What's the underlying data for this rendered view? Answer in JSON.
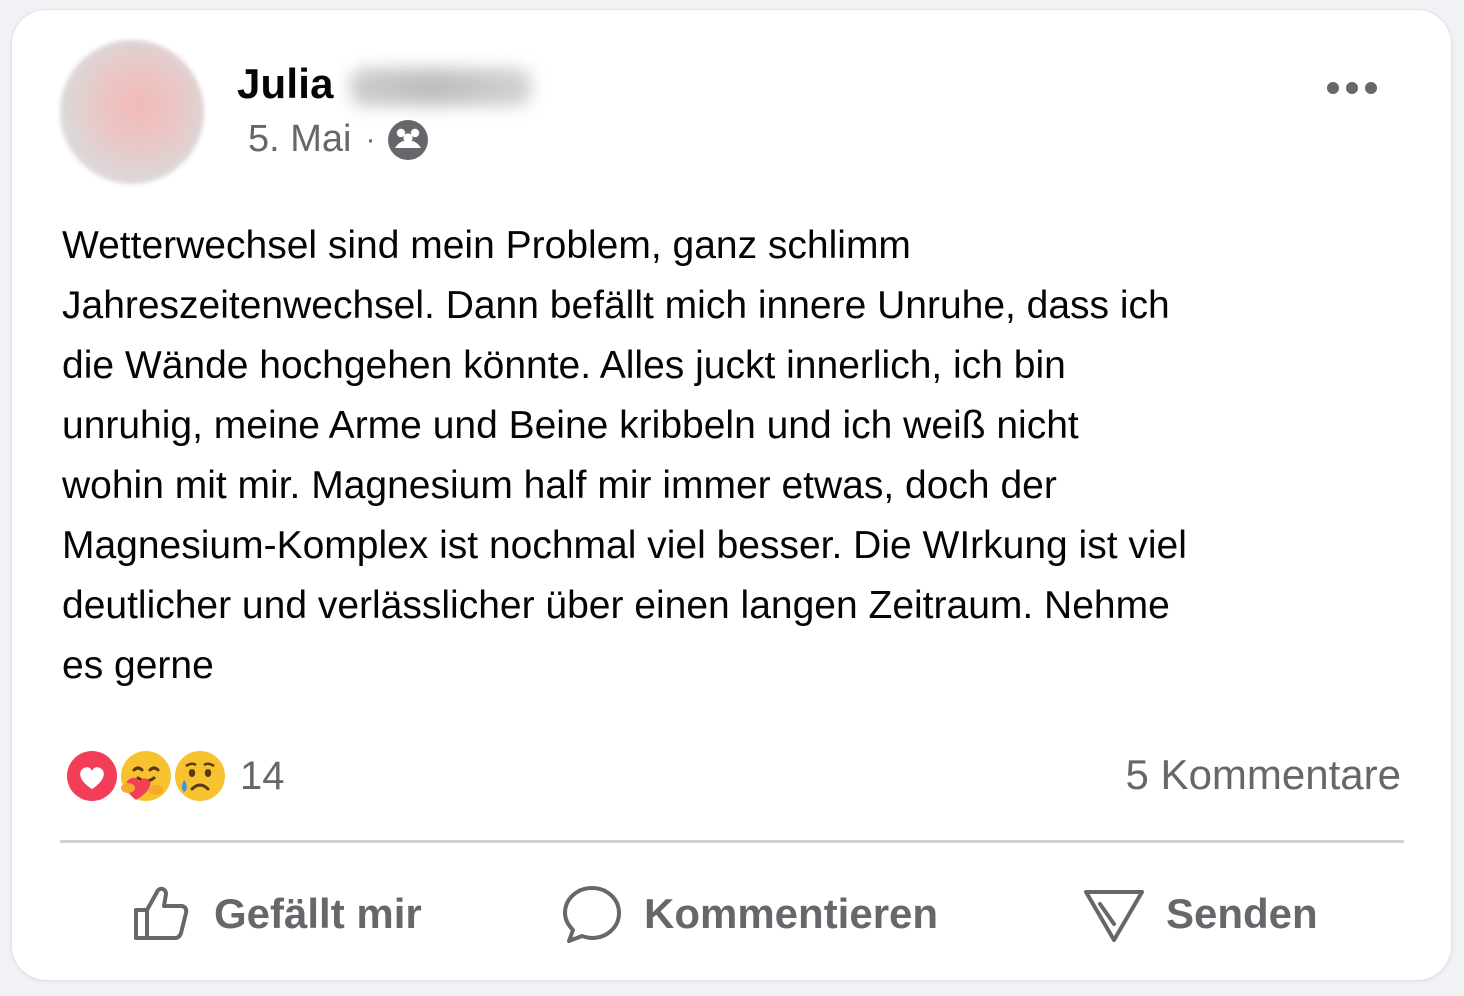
{
  "post": {
    "author_first_name": "Julia",
    "date": "5. Mai",
    "separator": "·",
    "audience_icon": "group-icon",
    "more_icon": "more-options-icon",
    "text": "Wetterwechsel sind mein Problem, ganz schlimm\nJahreszeitenwechsel. Dann befällt mich innere Unruhe, dass ich\ndie Wände hochgehen könnte. Alles juckt innerlich, ich bin\nunruhig, meine Arme und Beine kribbeln und ich weiß nicht\nwohin mit mir. Magnesium half mir immer etwas, doch der\nMagnesium-Komplex ist nochmal viel besser. Die WIrkung ist viel\ndeutlicher und verlässlicher über einen langen Zeitraum. Nehme\nes gerne"
  },
  "reactions": {
    "icons": [
      "love-icon",
      "care-icon",
      "sad-icon"
    ],
    "count": "14"
  },
  "comments": {
    "label": "5 Kommentare"
  },
  "actions": {
    "like_label": "Gefällt mir",
    "comment_label": "Kommentieren",
    "send_label": "Senden"
  },
  "colors": {
    "text_primary": "#050505",
    "text_secondary": "#65676b",
    "love_red": "#f33e58",
    "emoji_yellow": "#f7c22f",
    "divider": "#ced0d4"
  }
}
